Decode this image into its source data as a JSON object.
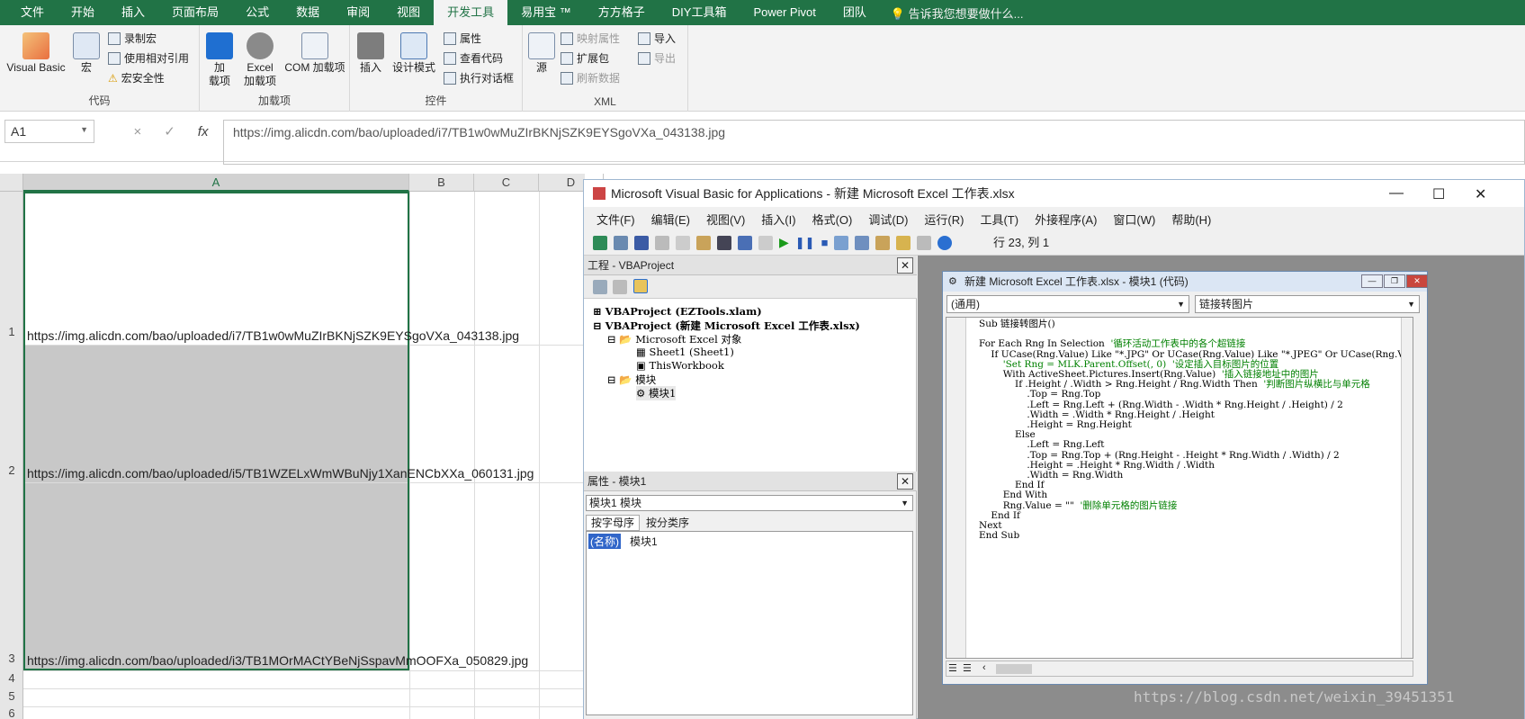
{
  "ribbon_tabs": [
    "文件",
    "开始",
    "插入",
    "页面布局",
    "公式",
    "数据",
    "审阅",
    "视图",
    "开发工具",
    "易用宝 ™",
    "方方格子",
    "DIY工具箱",
    "Power Pivot",
    "团队"
  ],
  "tell_me": "告诉我您想要做什么...",
  "ribbon": {
    "code": {
      "label": "代码",
      "visual_basic": "Visual Basic",
      "macro": "宏",
      "record": "录制宏",
      "relative": "使用相对引用",
      "security": "宏安全性"
    },
    "addins": {
      "label": "加载项",
      "addin": "加\n载项",
      "excel_addin": "Excel\n加载项",
      "com_addin": "COM 加载项"
    },
    "controls": {
      "label": "控件",
      "insert": "插入",
      "design": "设计模式",
      "properties": "属性",
      "view_code": "查看代码",
      "dialog": "执行对话框"
    },
    "xml": {
      "label": "XML",
      "source": "源",
      "map_props": "映射属性",
      "expand": "扩展包",
      "refresh": "刷新数据",
      "import": "导入",
      "export": "导出"
    }
  },
  "formula_bar": {
    "name_box": "A1",
    "cancel": "×",
    "enter": "✓",
    "fx": "fx",
    "formula": "https://img.alicdn.com/bao/uploaded/i7/TB1w0wMuZIrBKNjSZK9EYSgoVXa_043138.jpg"
  },
  "sheet": {
    "columns": [
      "A",
      "B",
      "C",
      "D"
    ],
    "rows": [
      "1",
      "2",
      "3",
      "4",
      "5",
      "6"
    ],
    "cells": [
      "https://img.alicdn.com/bao/uploaded/i7/TB1w0wMuZIrBKNjSZK9EYSgoVXa_043138.jpg",
      "https://img.alicdn.com/bao/uploaded/i5/TB1WZELxWmWBuNjy1XanENCbXXa_060131.jpg",
      "https://img.alicdn.com/bao/uploaded/i3/TB1MOrMACtYBeNjSspavMmOOFXa_050829.jpg"
    ]
  },
  "vbe": {
    "title": "Microsoft Visual Basic for Applications - 新建 Microsoft Excel 工作表.xlsx",
    "menu": [
      "文件(F)",
      "编辑(E)",
      "视图(V)",
      "插入(I)",
      "格式(O)",
      "调试(D)",
      "运行(R)",
      "工具(T)",
      "外接程序(A)",
      "窗口(W)",
      "帮助(H)"
    ],
    "position": "行 23, 列 1",
    "project_title": "工程 - VBAProject",
    "tree": [
      "VBAProject (EZTools.xlam)",
      "VBAProject (新建 Microsoft Excel 工作表.xlsx)",
      "Microsoft Excel 对象",
      "Sheet1 (Sheet1)",
      "ThisWorkbook",
      "模块",
      "模块1"
    ],
    "props_title": "属性 - 模块1",
    "props_combo": "模块1 模块",
    "props_tabs": [
      "按字母序",
      "按分类序"
    ],
    "prop_name": "(名称)",
    "prop_value": "模块1",
    "code_title": "新建 Microsoft Excel 工作表.xlsx - 模块1 (代码)",
    "combo_left": "(通用)",
    "combo_right": "链接转图片"
  },
  "code_lines": [
    {
      "t": "Sub 链接转图片()"
    },
    {
      "t": ""
    },
    {
      "t": "For Each Rng In Selection  ",
      "c": "'循环活动工作表中的各个超链接"
    },
    {
      "t": "    If UCase(Rng.Value) Like \"*.JPG\" Or UCase(Rng.Value) Like \"*.JPEG\" Or UCase(Rng.Va"
    },
    {
      "t": "        ",
      "c": "'Set Rng = MLK.Parent.Offset(, 0)  '设定插入目标图片的位置"
    },
    {
      "t": "        With ActiveSheet.Pictures.Insert(Rng.Value)  ",
      "c": "'插入链接地址中的图片"
    },
    {
      "t": "            If .Height / .Width > Rng.Height / Rng.Width Then  ",
      "c": "'判断图片纵横比与单元格"
    },
    {
      "t": "                .Top = Rng.Top"
    },
    {
      "t": "                .Left = Rng.Left + (Rng.Width - .Width * Rng.Height / .Height) / 2"
    },
    {
      "t": "                .Width = .Width * Rng.Height / .Height"
    },
    {
      "t": "                .Height = Rng.Height"
    },
    {
      "t": "            Else"
    },
    {
      "t": "                .Left = Rng.Left"
    },
    {
      "t": "                .Top = Rng.Top + (Rng.Height - .Height * Rng.Width / .Width) / 2"
    },
    {
      "t": "                .Height = .Height * Rng.Width / .Width"
    },
    {
      "t": "                .Width = Rng.Width"
    },
    {
      "t": "            End If"
    },
    {
      "t": "        End With"
    },
    {
      "t": "        Rng.Value = \"\"  ",
      "c": "'删除单元格的图片链接"
    },
    {
      "t": "    End If"
    },
    {
      "t": "Next"
    },
    {
      "t": "End Sub"
    }
  ],
  "watermark": "https://blog.csdn.net/weixin_39451351",
  "colors": {
    "excel_green": "#217346",
    "comment_green": "#008000",
    "keyword_blue": "#00008b"
  }
}
